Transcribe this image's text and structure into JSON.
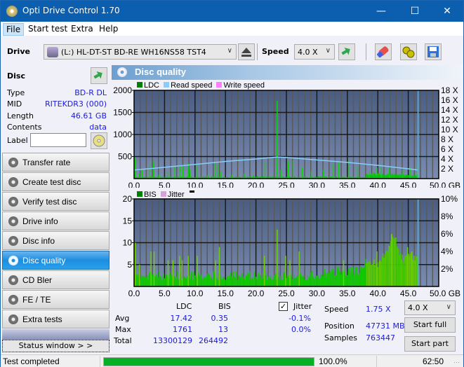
{
  "window": {
    "title": "Opti Drive Control 1.70",
    "controls": {
      "minimize": "—",
      "maximize": "☐",
      "close": "✕"
    }
  },
  "menu": {
    "items": [
      {
        "label": "File"
      },
      {
        "label": "Start test"
      },
      {
        "label": "Extra"
      },
      {
        "label": "Help"
      }
    ]
  },
  "toolbar": {
    "drive_label": "Drive",
    "drive_value": "(L:)   HL-DT-ST BD-RE  WH16NS58 TST4",
    "speed_label": "Speed",
    "speed_value": "4.0 X",
    "icons": [
      "eject-icon",
      "refresh-icon",
      "erase-icon",
      "settings-icon",
      "save-icon"
    ]
  },
  "disc": {
    "header": "Disc",
    "fields": [
      {
        "key": "Type",
        "value": "BD-R DL"
      },
      {
        "key": "MID",
        "value": "RITEKDR3 (000)"
      },
      {
        "key": "Length",
        "value": "46.61 GB"
      },
      {
        "key": "Contents",
        "value": "data"
      }
    ],
    "label_key": "Label",
    "label_value": ""
  },
  "nav": {
    "items": [
      {
        "label": "Transfer rate",
        "active": false
      },
      {
        "label": "Create test disc",
        "active": false
      },
      {
        "label": "Verify test disc",
        "active": false
      },
      {
        "label": "Drive info",
        "active": false
      },
      {
        "label": "Disc info",
        "active": false
      },
      {
        "label": "Disc quality",
        "active": true
      },
      {
        "label": "CD Bler",
        "active": false
      },
      {
        "label": "FE / TE",
        "active": false
      },
      {
        "label": "Extra tests",
        "active": false
      }
    ],
    "status_window": "Status window > >"
  },
  "panel": {
    "title": "Disc quality"
  },
  "chart_data": [
    {
      "type": "bar",
      "title": "LDC",
      "legend": [
        {
          "name": "LDC",
          "color": "#008000"
        },
        {
          "name": "Read speed",
          "color": "#87cefa"
        },
        {
          "name": "Write speed",
          "color": "#ff80ff"
        }
      ],
      "legend_position": "top-left",
      "xlabel": "GB",
      "x_ticks": [
        "0.0",
        "5.0",
        "10.0",
        "15.0",
        "20.0",
        "25.0",
        "30.0",
        "35.0",
        "40.0",
        "45.0",
        "50.0 GB"
      ],
      "xlim": [
        0,
        50
      ],
      "y_ticks_left": [
        "2000",
        "1500",
        "1000",
        "500"
      ],
      "ylim_left": [
        0,
        2000
      ],
      "y_ticks_right": [
        "18 X",
        "16 X",
        "14 X",
        "12 X",
        "10 X",
        "8 X",
        "6 X",
        "4 X",
        "2 X"
      ],
      "ylim_right": [
        0,
        18
      ],
      "grid": true,
      "end_marker_gb": 46.61,
      "ldc_spikes": [
        {
          "x": 0.1,
          "y": 470
        },
        {
          "x": 0.8,
          "y": 120
        },
        {
          "x": 1.2,
          "y": 200
        },
        {
          "x": 2.5,
          "y": 280
        },
        {
          "x": 3.1,
          "y": 390
        },
        {
          "x": 4.0,
          "y": 90
        },
        {
          "x": 5.5,
          "y": 150
        },
        {
          "x": 6.6,
          "y": 280
        },
        {
          "x": 7.4,
          "y": 320
        },
        {
          "x": 7.9,
          "y": 300
        },
        {
          "x": 8.8,
          "y": 340
        },
        {
          "x": 9.1,
          "y": 200
        },
        {
          "x": 10.3,
          "y": 330
        },
        {
          "x": 12.0,
          "y": 80
        },
        {
          "x": 13.3,
          "y": 380
        },
        {
          "x": 13.6,
          "y": 300
        },
        {
          "x": 14.1,
          "y": 150
        },
        {
          "x": 16.0,
          "y": 90
        },
        {
          "x": 18.0,
          "y": 120
        },
        {
          "x": 19.5,
          "y": 90
        },
        {
          "x": 21.4,
          "y": 370
        },
        {
          "x": 23.4,
          "y": 1761
        },
        {
          "x": 24.0,
          "y": 200
        },
        {
          "x": 25.2,
          "y": 400
        },
        {
          "x": 26.0,
          "y": 420
        },
        {
          "x": 27.5,
          "y": 260
        },
        {
          "x": 29.0,
          "y": 170
        },
        {
          "x": 31.0,
          "y": 200
        },
        {
          "x": 32.5,
          "y": 330
        },
        {
          "x": 33.5,
          "y": 360
        },
        {
          "x": 35.2,
          "y": 400
        },
        {
          "x": 36.6,
          "y": 280
        },
        {
          "x": 38.5,
          "y": 160
        },
        {
          "x": 39.8,
          "y": 250
        },
        {
          "x": 40.5,
          "y": 270
        },
        {
          "x": 41.8,
          "y": 230
        },
        {
          "x": 44.0,
          "y": 200
        },
        {
          "x": 45.2,
          "y": 240
        },
        {
          "x": 46.5,
          "y": 300
        }
      ],
      "read_speed_points": [
        {
          "x": 0,
          "y": 1.75
        },
        {
          "x": 5,
          "y": 2.3
        },
        {
          "x": 10,
          "y": 2.9
        },
        {
          "x": 15,
          "y": 3.5
        },
        {
          "x": 20,
          "y": 4.0
        },
        {
          "x": 23.4,
          "y": 4.4
        },
        {
          "x": 25,
          "y": 4.3
        },
        {
          "x": 30,
          "y": 3.8
        },
        {
          "x": 35,
          "y": 3.3
        },
        {
          "x": 40,
          "y": 2.7
        },
        {
          "x": 45,
          "y": 2.0
        },
        {
          "x": 46.6,
          "y": 1.75
        }
      ]
    },
    {
      "type": "bar",
      "title": "BIS",
      "legend": [
        {
          "name": "BIS",
          "color": "#008000"
        },
        {
          "name": "Jitter",
          "color": "#d8a0d8"
        }
      ],
      "legend_position": "top-left",
      "xlabel": "GB",
      "x_ticks": [
        "0.0",
        "5.0",
        "10.0",
        "15.0",
        "20.0",
        "25.0",
        "30.0",
        "35.0",
        "40.0",
        "45.0",
        "50.0 GB"
      ],
      "xlim": [
        0,
        50
      ],
      "y_ticks_left": [
        "20",
        "15",
        "10",
        "5"
      ],
      "ylim_left": [
        0,
        20
      ],
      "y_ticks_right": [
        "10%",
        "8%",
        "6%",
        "4%",
        "2%"
      ],
      "ylim_right": [
        0,
        10
      ],
      "grid": true,
      "end_marker_gb": 46.61,
      "bis_profile": [
        {
          "x": 0,
          "y": 2
        },
        {
          "x": 5,
          "y": 2
        },
        {
          "x": 10,
          "y": 2
        },
        {
          "x": 15,
          "y": 2
        },
        {
          "x": 20,
          "y": 2
        },
        {
          "x": 25,
          "y": 2
        },
        {
          "x": 30,
          "y": 2
        },
        {
          "x": 32,
          "y": 3
        },
        {
          "x": 35,
          "y": 3
        },
        {
          "x": 37,
          "y": 3
        },
        {
          "x": 38,
          "y": 5
        },
        {
          "x": 40,
          "y": 5
        },
        {
          "x": 41,
          "y": 7
        },
        {
          "x": 42,
          "y": 10
        },
        {
          "x": 42.5,
          "y": 12
        },
        {
          "x": 43,
          "y": 9
        },
        {
          "x": 44,
          "y": 6
        },
        {
          "x": 45,
          "y": 7
        },
        {
          "x": 46.6,
          "y": 6
        }
      ],
      "bis_spikes": [
        {
          "x": 0.1,
          "y": 10
        },
        {
          "x": 0.8,
          "y": 5
        },
        {
          "x": 2.7,
          "y": 8
        },
        {
          "x": 3.2,
          "y": 8
        },
        {
          "x": 5.5,
          "y": 6
        },
        {
          "x": 6.3,
          "y": 6
        },
        {
          "x": 7.4,
          "y": 7
        },
        {
          "x": 7.8,
          "y": 6
        },
        {
          "x": 8.8,
          "y": 7
        },
        {
          "x": 10.3,
          "y": 7
        },
        {
          "x": 13.3,
          "y": 6
        },
        {
          "x": 13.9,
          "y": 9
        },
        {
          "x": 21.3,
          "y": 7
        },
        {
          "x": 23.4,
          "y": 13
        },
        {
          "x": 24.8,
          "y": 7
        },
        {
          "x": 25.5,
          "y": 6
        },
        {
          "x": 27.0,
          "y": 8
        },
        {
          "x": 34.3,
          "y": 6
        },
        {
          "x": 39.8,
          "y": 8
        },
        {
          "x": 42.2,
          "y": 12
        },
        {
          "x": 44.8,
          "y": 9
        },
        {
          "x": 45.5,
          "y": 8
        }
      ]
    }
  ],
  "stats": {
    "col_ldc": "LDC",
    "col_bis": "BIS",
    "rows": [
      {
        "label": "Avg",
        "ldc": "17.42",
        "bis": "0.35",
        "jitter": "-0.1%"
      },
      {
        "label": "Max",
        "ldc": "1761",
        "bis": "13",
        "jitter": "0.0%"
      },
      {
        "label": "Total",
        "ldc": "13300129",
        "bis": "264492",
        "jitter": ""
      }
    ],
    "jitter_label": "Jitter",
    "jitter_checked": true,
    "speed_label": "Speed",
    "speed_value": "1.75 X",
    "position_label": "Position",
    "position_value": "47731 MB",
    "samples_label": "Samples",
    "samples_value": "763447",
    "speed_select": "4.0 X",
    "start_full": "Start full",
    "start_part": "Start part"
  },
  "statusbar": {
    "text": "Test completed",
    "progress_percent": 100.0,
    "progress_text": "100.0%",
    "time": "62:50"
  }
}
